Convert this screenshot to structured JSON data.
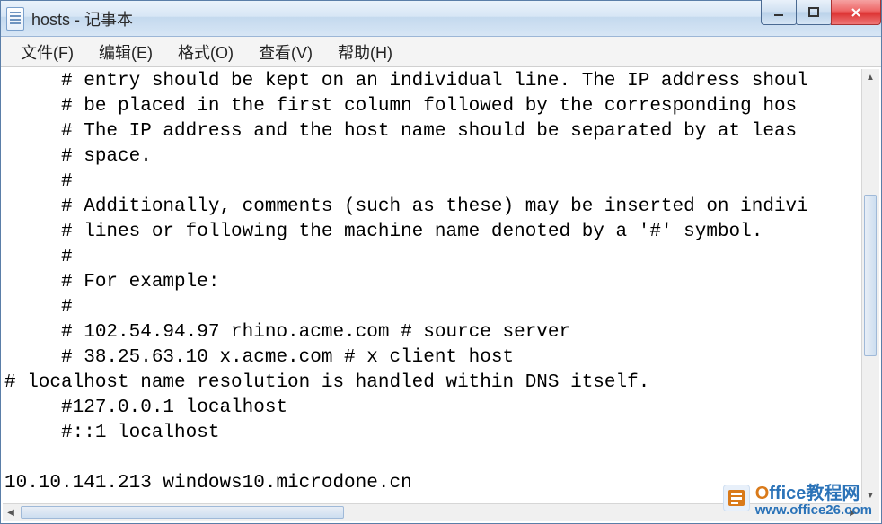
{
  "window": {
    "title": "hosts - 记事本"
  },
  "menu": {
    "file": "文件(F)",
    "edit": "编辑(E)",
    "format": "格式(O)",
    "view": "查看(V)",
    "help": "帮助(H)"
  },
  "editor": {
    "lines": [
      "     # entry should be kept on an individual line. The IP address shoul",
      "     # be placed in the first column followed by the corresponding hos",
      "     # The IP address and the host name should be separated by at leas",
      "     # space.",
      "     #",
      "     # Additionally, comments (such as these) may be inserted on indivi",
      "     # lines or following the machine name denoted by a '#' symbol.",
      "     #",
      "     # For example:",
      "     #",
      "     # 102.54.94.97 rhino.acme.com # source server",
      "     # 38.25.63.10 x.acme.com # x client host",
      "# localhost name resolution is handled within DNS itself.",
      "     #127.0.0.1 localhost",
      "     #::1 localhost",
      "",
      "10.10.141.213 windows10.microdone.cn"
    ]
  },
  "watermark": {
    "brand_prefix": "O",
    "brand_rest": "ffice教程网",
    "url": "www.office26.com"
  }
}
